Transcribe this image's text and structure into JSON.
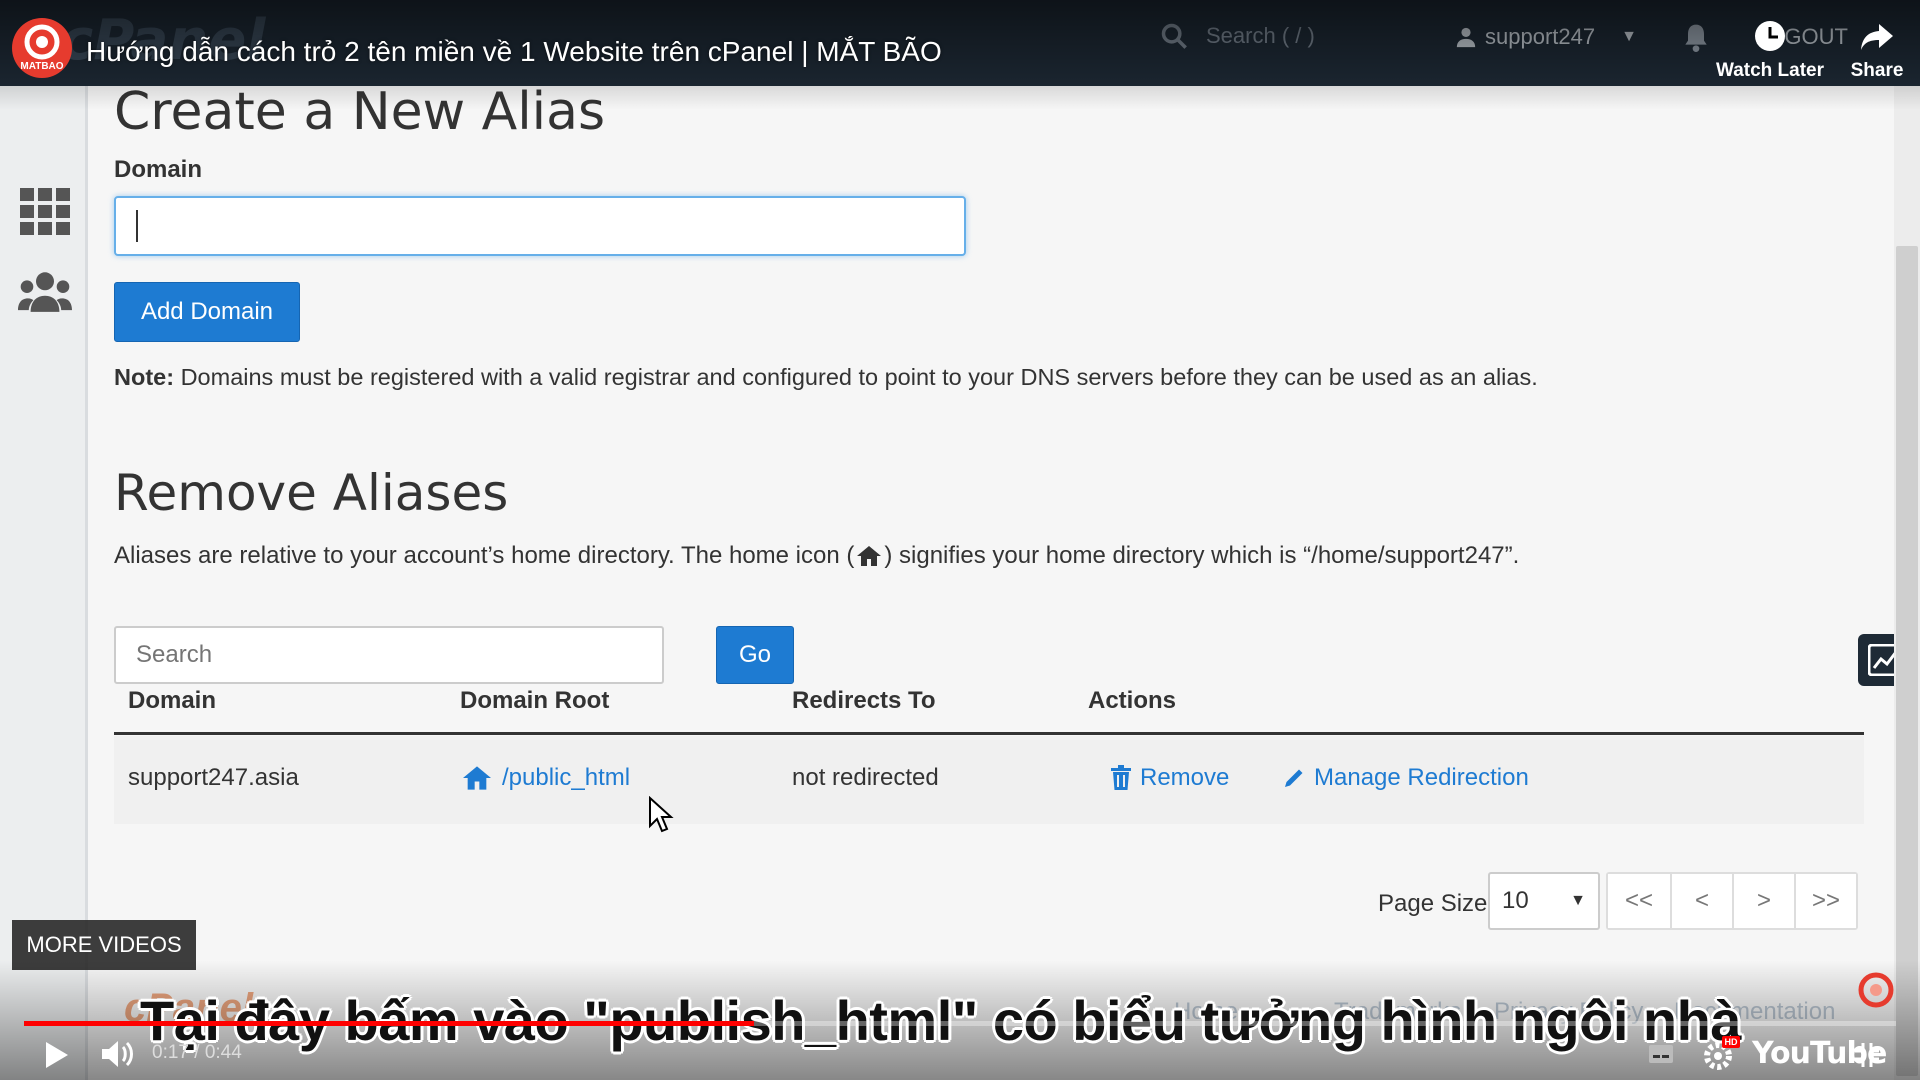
{
  "video": {
    "title": "Hướng dẫn cách trỏ 2 tên miền về 1 Website trên cPanel | MẮT BÃO",
    "channel_logo_text": "MATBAO",
    "watch_later_label": "Watch Later",
    "share_label": "Share",
    "more_videos_label": "MORE VIDEOS",
    "caption": "Tại đây bấm vào \"publish_html\" có biểu tưởng hình ngôi nhà",
    "time_current": "0:17",
    "time_total": "0:44",
    "time_display": "0:17 / 0:44",
    "progress": 0.39,
    "wordmark": "YouTube",
    "accent_color": "#ff0000"
  },
  "cpanel": {
    "topbar": {
      "search_placeholder": "Search ( / )",
      "username": "support247",
      "logout_label": "LOGOUT"
    },
    "create": {
      "heading": "Create a New Alias",
      "domain_label": "Domain",
      "domain_value": "",
      "add_button": "Add Domain",
      "note_label": "Note:",
      "note_text": " Domains must be registered with a valid registrar and configured to point to your DNS servers before they can be used as an alias."
    },
    "remove": {
      "heading": "Remove Aliases",
      "desc_before": "Aliases are relative to your account’s home directory. The home icon (",
      "desc_after": ") signifies your home directory which is “/home/support247”.",
      "search_placeholder": "Search",
      "go_button": "Go",
      "columns": [
        "Domain",
        "Domain Root",
        "Redirects To",
        "Actions"
      ],
      "rows": [
        {
          "domain": "support247.asia",
          "root": "/public_html",
          "redirects": "not redirected",
          "remove_label": "Remove",
          "manage_label": "Manage Redirection"
        }
      ],
      "page_size_label": "Page Size",
      "page_size_value": "10",
      "pager": [
        "<<",
        "<",
        ">",
        ">>"
      ]
    },
    "footer_ghost": [
      "cPanel",
      "Home",
      "Trademarks",
      "Privacy Policy",
      "Documentation"
    ],
    "link_color": "#1e7bd2",
    "button_color": "#1e7bd2"
  }
}
